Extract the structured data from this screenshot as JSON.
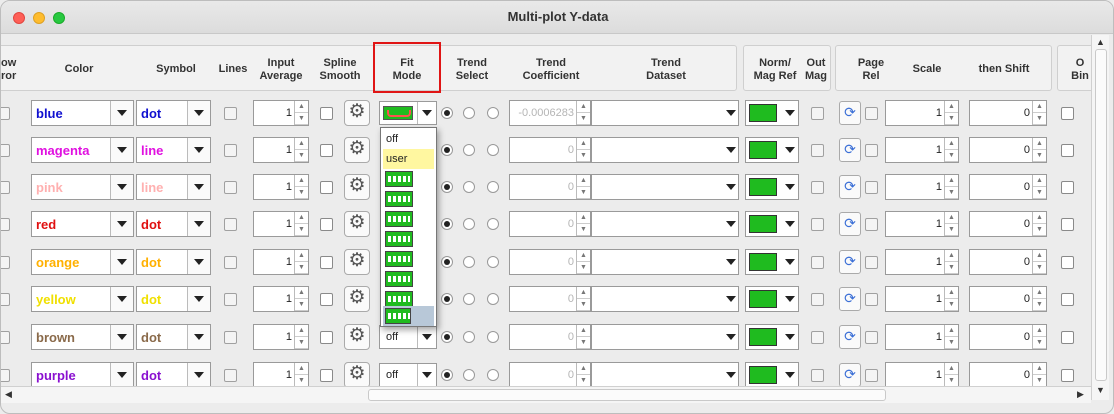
{
  "window": {
    "title": "Multi-plot Y-data"
  },
  "columns": {
    "show_error": "ow\nror",
    "color": "Color",
    "symbol": "Symbol",
    "lines": "Lines",
    "input_average": "Input\nAverage",
    "spline_smooth": "Spline\nSmooth",
    "fit_mode": "Fit\nMode",
    "trend_select": "Trend\nSelect",
    "trend_coefficient": "Trend\nCoefficient",
    "trend_dataset": "Trend\nDataset",
    "norm_mag_ref": "Norm/\nMag Ref",
    "out_mag": "Out\nMag",
    "page_rel": "Page\nRel",
    "scale": "Scale",
    "then_shift": "then Shift",
    "o_bin": "O\nBin"
  },
  "rows": [
    {
      "color": "blue",
      "color_hex": "#1010d0",
      "symbol": "dot",
      "symbol_hex": "#1010d0",
      "avg": "1",
      "fit": "icon",
      "coef": "-0.0006283",
      "scale": "1",
      "shift": "0"
    },
    {
      "color": "magenta",
      "color_hex": "#e010e0",
      "symbol": "line",
      "symbol_hex": "#e010e0",
      "avg": "1",
      "fit": "",
      "coef": "0",
      "scale": "1",
      "shift": "0"
    },
    {
      "color": "pink",
      "color_hex": "#ffb0b0",
      "symbol": "line",
      "symbol_hex": "#ffb0b0",
      "avg": "1",
      "fit": "",
      "coef": "0",
      "scale": "1",
      "shift": "0"
    },
    {
      "color": "red",
      "color_hex": "#e01010",
      "symbol": "dot",
      "symbol_hex": "#e01010",
      "avg": "1",
      "fit": "",
      "coef": "0",
      "scale": "1",
      "shift": "0"
    },
    {
      "color": "orange",
      "color_hex": "#ffb000",
      "symbol": "dot",
      "symbol_hex": "#ffb000",
      "avg": "1",
      "fit": "",
      "coef": "0",
      "scale": "1",
      "shift": "0"
    },
    {
      "color": "yellow",
      "color_hex": "#f0e000",
      "symbol": "dot",
      "symbol_hex": "#f0e000",
      "avg": "1",
      "fit": "",
      "coef": "0",
      "scale": "1",
      "shift": "0"
    },
    {
      "color": "brown",
      "color_hex": "#8a6a4a",
      "symbol": "dot",
      "symbol_hex": "#8a6a4a",
      "avg": "1",
      "fit": "off",
      "coef": "0",
      "scale": "1",
      "shift": "0"
    },
    {
      "color": "purple",
      "color_hex": "#8a10d0",
      "symbol": "dot",
      "symbol_hex": "#8a10d0",
      "avg": "1",
      "fit": "off",
      "coef": "0",
      "scale": "1",
      "shift": "0"
    }
  ],
  "fit_popup": {
    "items": [
      "off",
      "user",
      "fit-1",
      "fit-2",
      "fit-3",
      "fit-4",
      "fit-5",
      "fit-6",
      "fit-7",
      "fit-8"
    ]
  },
  "icons": {
    "gear": "gear-icon",
    "page_rel": "refresh-icon"
  }
}
